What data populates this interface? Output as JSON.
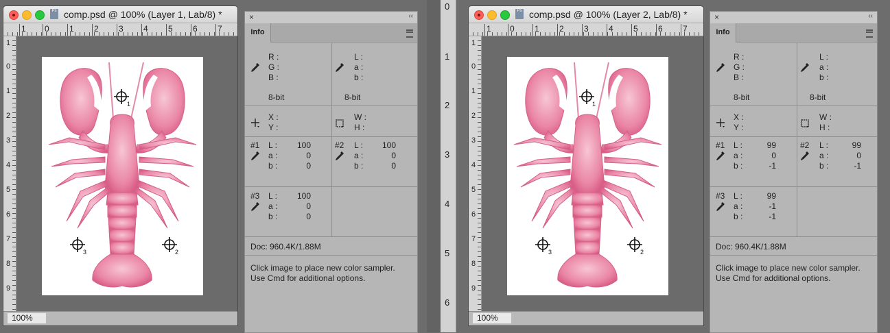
{
  "left": {
    "window_title": "comp.psd @ 100% (Layer 1, Lab/8) *",
    "zoom": "100%",
    "ruler_h": [
      "1",
      "0",
      "1",
      "2",
      "3",
      "4",
      "5",
      "6",
      "7"
    ],
    "ruler_v": [
      "1",
      "0",
      "1",
      "2",
      "3",
      "4",
      "5",
      "6",
      "7",
      "8",
      "9"
    ],
    "sampler_labels": [
      "1",
      "2",
      "3"
    ],
    "info": {
      "rgb_labels": [
        "R :",
        "G :",
        "B :"
      ],
      "lab_labels": [
        "L :",
        "a :",
        "b :"
      ],
      "bit_left": "8-bit",
      "bit_right": "8-bit",
      "xy_labels": [
        "X :",
        "Y :"
      ],
      "wh_labels": [
        "W :",
        "H :"
      ],
      "s1": {
        "id": "#1",
        "labels": [
          "L :",
          "a :",
          "b :"
        ],
        "values": [
          "100",
          "0",
          "0"
        ]
      },
      "s2": {
        "id": "#2",
        "labels": [
          "L :",
          "a :",
          "b :"
        ],
        "values": [
          "100",
          "0",
          "0"
        ]
      },
      "s3": {
        "id": "#3",
        "labels": [
          "L :",
          "a :",
          "b :"
        ],
        "values": [
          "100",
          "0",
          "0"
        ]
      },
      "doc": "Doc: 960.4K/1.88M",
      "hint1": "Click image to place new color sampler.",
      "hint2": "Use Cmd for additional options."
    }
  },
  "right": {
    "window_title": "comp.psd @ 100% (Layer 2, Lab/8) *",
    "zoom": "100%",
    "ruler_h": [
      "1",
      "0",
      "1",
      "2",
      "3",
      "4",
      "5",
      "6",
      "7"
    ],
    "ruler_v": [
      "1",
      "0",
      "1",
      "2",
      "3",
      "4",
      "5",
      "6",
      "7",
      "8",
      "9"
    ],
    "sampler_labels": [
      "1",
      "2",
      "3"
    ],
    "info": {
      "rgb_labels": [
        "R :",
        "G :",
        "B :"
      ],
      "lab_labels": [
        "L :",
        "a :",
        "b :"
      ],
      "bit_left": "8-bit",
      "bit_right": "8-bit",
      "xy_labels": [
        "X :",
        "Y :"
      ],
      "wh_labels": [
        "W :",
        "H :"
      ],
      "s1": {
        "id": "#1",
        "labels": [
          "L :",
          "a :",
          "b :"
        ],
        "values": [
          "99",
          "0",
          "-1"
        ]
      },
      "s2": {
        "id": "#2",
        "labels": [
          "L :",
          "a :",
          "b :"
        ],
        "values": [
          "99",
          "0",
          "-1"
        ]
      },
      "s3": {
        "id": "#3",
        "labels": [
          "L :",
          "a :",
          "b :"
        ],
        "values": [
          "99",
          "-1",
          "-1"
        ]
      },
      "doc": "Doc: 960.4K/1.88M",
      "hint1": "Click image to place new color sampler.",
      "hint2": "Use Cmd for additional options."
    }
  },
  "between_ruler": [
    "0",
    "1",
    "2",
    "3",
    "4",
    "5",
    "6"
  ],
  "panel_tab": "Info",
  "panel_close": "×",
  "panel_collapse": "‹‹",
  "colors": {
    "lobster": "#e8779a",
    "lobster_dark": "#cf4f79",
    "panel": "#b6b6b6",
    "canvas_bg": "#6b6b6b"
  }
}
